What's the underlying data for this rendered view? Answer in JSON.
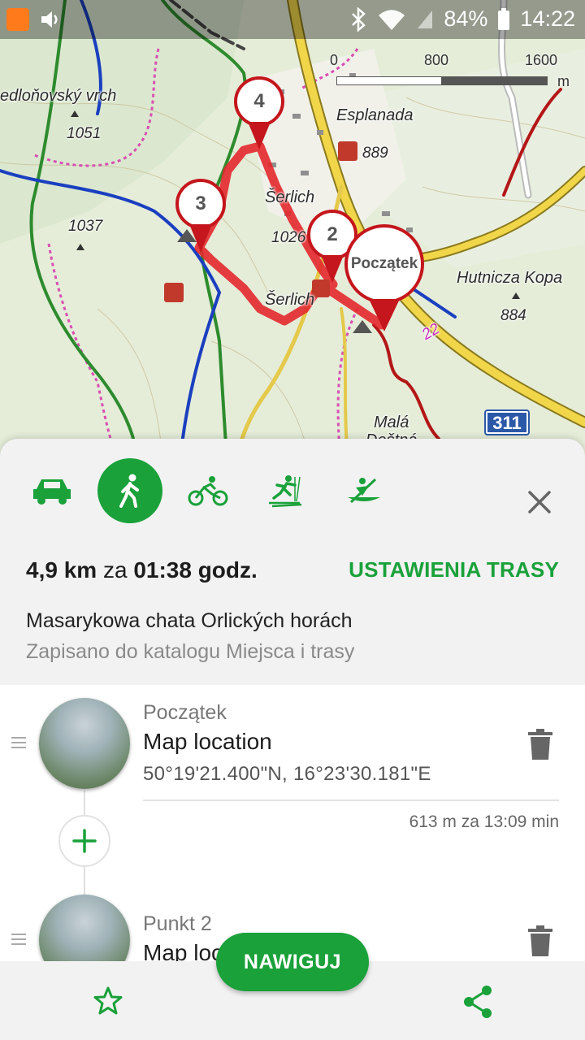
{
  "status_bar": {
    "battery": "84%",
    "time": "14:22"
  },
  "map": {
    "labels": {
      "hill_left": "edloňovský vrch",
      "elev_1051": "1051",
      "elev_1037": "1037",
      "esplanada": "Esplanada",
      "elev_889": "889",
      "serlich_top": "Šerlich",
      "elev_1026": "1026",
      "serlich_bottom": "Šerlich",
      "hutnicza_kopa": "Hutnicza Kopa",
      "elev_884": "884",
      "mala": "Malá",
      "dostna": "Deštná",
      "road_22": "22",
      "road_311": "311"
    },
    "scale": {
      "zero": "0",
      "mid": "800",
      "max": "1600",
      "unit": "m"
    },
    "pins": {
      "p4": "4",
      "p3": "3",
      "p2": "2",
      "start": "Początek"
    }
  },
  "transport_modes": [
    "car-icon",
    "walk-icon",
    "bike-icon",
    "ski-icon",
    "canoe-icon"
  ],
  "active_mode": "walk",
  "summary": {
    "distance": "4,9 km",
    "connector": "za",
    "duration": "01:38 godz."
  },
  "route_settings_label": "USTAWIENIA TRASY",
  "route_name": "Masarykowa chata Orlických horách",
  "route_saved": "Zapisano do katalogu Miejsca i trasy",
  "waypoints": [
    {
      "kind": "Początek",
      "title": "Map location",
      "coords": "50°19'21.400\"N, 16°23'30.181\"E",
      "leg": "613 m za 13:09 min"
    },
    {
      "kind": "Punkt 2",
      "title": "Map location"
    }
  ],
  "navigate_label": "NAWIGUJ",
  "colors": {
    "accent_green": "#1aa13a",
    "route_red": "#e3282c",
    "pin_red": "#c4161c"
  }
}
